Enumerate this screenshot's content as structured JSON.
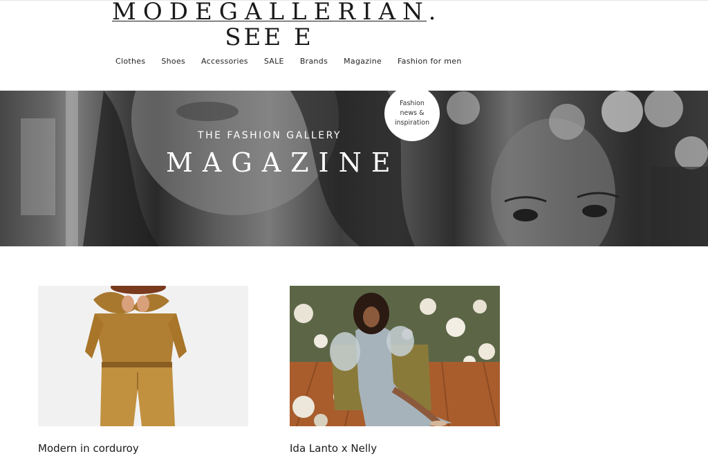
{
  "brand": {
    "line1": "MODEGALLERIAN.",
    "line2": "SEE E"
  },
  "nav": {
    "items": [
      "Clothes",
      "Shoes",
      "Accessories",
      "SALE",
      "Brands",
      "Magazine",
      "Fashion for men"
    ]
  },
  "hero": {
    "eyebrow": "THE FASHION GALLERY",
    "title": "MAGAZINE",
    "badge": "Fashion news & inspiration"
  },
  "articles": [
    {
      "title": "Modern in corduroy"
    },
    {
      "title": "Ida Lanto x Nelly"
    }
  ],
  "colors": {
    "text": "#1a1a1a",
    "background": "#ffffff",
    "hero_text": "#ffffff"
  }
}
